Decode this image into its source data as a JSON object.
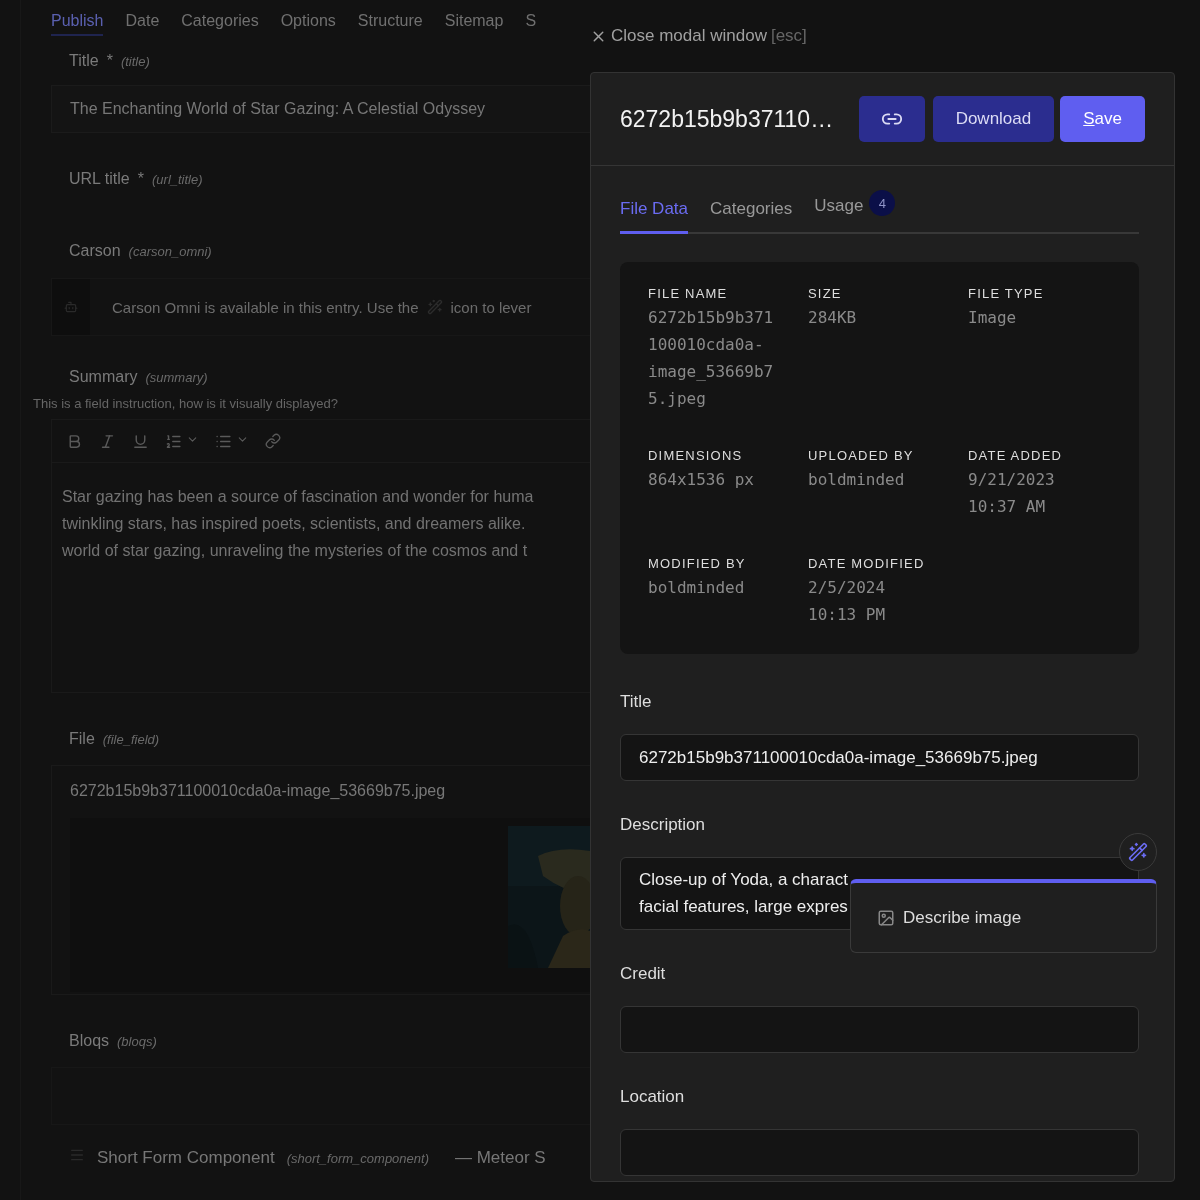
{
  "background": {
    "tabs": [
      {
        "label": "Publish",
        "selected": true
      },
      {
        "label": "Date",
        "selected": false
      },
      {
        "label": "Categories",
        "selected": false
      },
      {
        "label": "Options",
        "selected": false
      },
      {
        "label": "Structure",
        "selected": false
      },
      {
        "label": "Sitemap",
        "selected": false
      },
      {
        "label": "S",
        "selected": false
      }
    ],
    "fields": [
      {
        "kind": "text",
        "label": "Title",
        "required_mark": "*",
        "handle": "(title)",
        "value": "The Enchanting World of Star Gazing: A Celestial Odyssey"
      },
      {
        "kind": "label_only",
        "label": "URL title",
        "required_mark": "*",
        "handle": "(url_title)"
      },
      {
        "kind": "notice",
        "label": "Carson",
        "handle": "(carson_omni)",
        "before": "Carson Omni is available in this entry. Use the",
        "after": "icon to lever"
      },
      {
        "kind": "rich",
        "label": "Summary",
        "handle": "(summary)",
        "instructions": "This is a field instruction, how is it visually displayed?",
        "lines": [
          "Star gazing has been a source of fascination and wonder for huma",
          "twinkling stars, has inspired poets, scientists, and dreamers alike.",
          "world of star gazing, unraveling the mysteries of the cosmos and t"
        ]
      },
      {
        "kind": "file",
        "label": "File",
        "handle": "(file_field)",
        "filename": "6272b15b9b371100010cda0a-image_53669b75.jpeg"
      },
      {
        "kind": "bloqs",
        "label": "Bloqs",
        "handle": "(bloqs)"
      }
    ],
    "component": {
      "name": "Short Form Component",
      "handle": "(short_form_component)",
      "trail": "— Meteor S"
    }
  },
  "close": {
    "label": "Close modal window",
    "shortcut": "[esc]"
  },
  "modal": {
    "title": "6272b15b9b37110…",
    "buttons": [
      {
        "kind": "icon"
      },
      {
        "kind": "secondary",
        "label": "Download"
      },
      {
        "kind": "primary",
        "label": "Save"
      }
    ],
    "tabs": [
      {
        "label": "File Data",
        "selected": true
      },
      {
        "label": "Categories",
        "selected": false
      },
      {
        "label": "Usage",
        "selected": false,
        "badge": "4"
      }
    ],
    "meta": [
      {
        "label": "FILE NAME",
        "lines": [
          "6272b15b9b371",
          "100010cda0a-",
          "image_53669b7",
          "5.jpeg"
        ]
      },
      {
        "label": "SIZE",
        "lines": [
          "284KB"
        ]
      },
      {
        "label": "FILE TYPE",
        "lines": [
          "Image"
        ]
      },
      {
        "label": "DIMENSIONS",
        "lines": [
          "864x1536 px"
        ]
      },
      {
        "label": "UPLOADED BY",
        "lines": [
          "boldminded"
        ]
      },
      {
        "label": "DATE ADDED",
        "lines": [
          "9/21/2023",
          "10:37 AM"
        ]
      },
      {
        "label": "MODIFIED BY",
        "lines": [
          "boldminded"
        ]
      },
      {
        "label": "DATE MODIFIED",
        "lines": [
          "2/5/2024",
          "10:13 PM"
        ]
      }
    ],
    "form": [
      {
        "kind": "input",
        "label": "Title",
        "value": "6272b15b9b371100010cda0a-image_53669b75.jpeg"
      },
      {
        "kind": "textarea",
        "label": "Description",
        "lines": [
          "Close-up of Yoda, a charact",
          "facial features, large expres"
        ],
        "menu": [
          "Describe image"
        ]
      },
      {
        "kind": "input",
        "label": "Credit"
      },
      {
        "kind": "input",
        "label": "Location"
      }
    ]
  }
}
